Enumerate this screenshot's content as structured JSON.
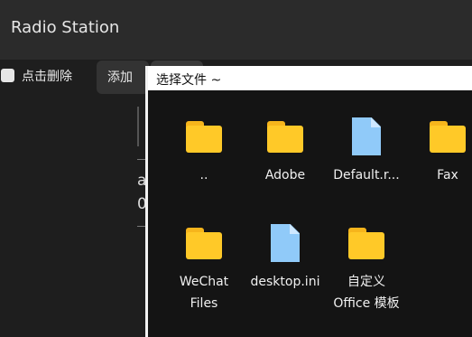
{
  "app": {
    "title": "Radio Station"
  },
  "toolbar": {
    "delete_on_click_label": "点击删除",
    "add_label": "添加"
  },
  "background": {
    "line1": "a",
    "line2": "0"
  },
  "dialog": {
    "title": "选择文件 ~",
    "items": [
      {
        "name": "..",
        "type": "folder-icon"
      },
      {
        "name": "Adobe",
        "type": "folder-icon"
      },
      {
        "name": "Default.r...",
        "type": "file-icon"
      },
      {
        "name": "Fax",
        "type": "folder-icon"
      },
      {
        "name": "WeChat",
        "name2": "Files",
        "type": "folder-icon"
      },
      {
        "name": "desktop.ini",
        "type": "file-icon"
      },
      {
        "name": "自定义",
        "name2": "Office 模板",
        "type": "folder-icon"
      }
    ]
  },
  "colors": {
    "folder": "#ffc928",
    "file": "#90caf9",
    "dialog_bg": "#141414",
    "header_bg": "#ffffff"
  }
}
